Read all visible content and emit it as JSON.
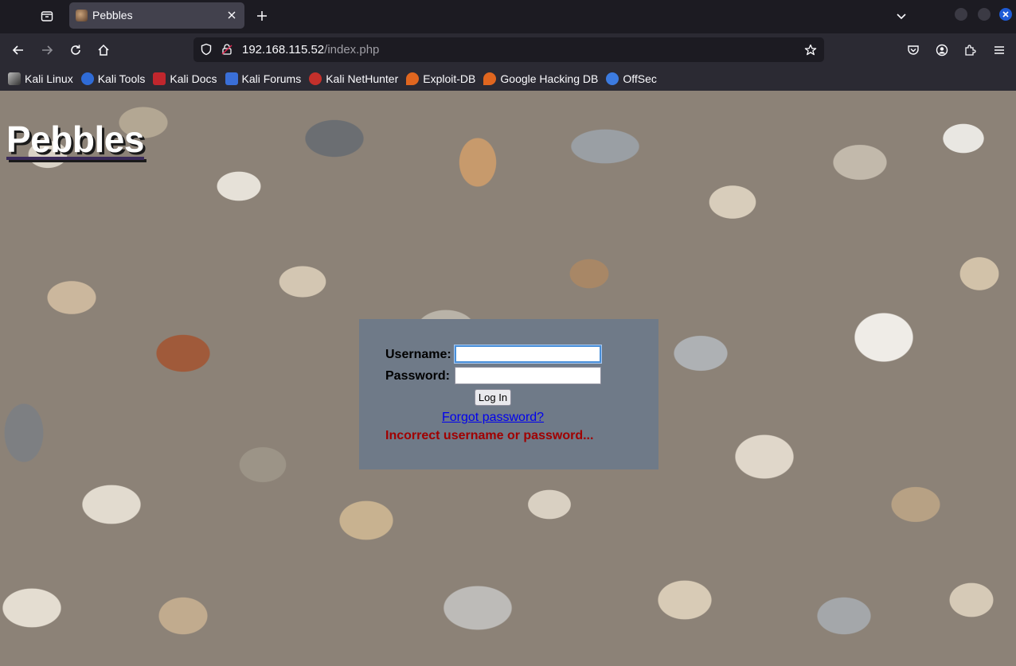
{
  "browser": {
    "tab": {
      "title": "Pebbles"
    },
    "url": {
      "host": "192.168.115.52",
      "path": "/index.php"
    },
    "bookmarks": [
      {
        "label": "Kali Linux",
        "icon": "kali-dragon-icon",
        "color": "#2b2a33"
      },
      {
        "label": "Kali Tools",
        "icon": "kali-tools-icon",
        "color": "#2f6bd6"
      },
      {
        "label": "Kali Docs",
        "icon": "kali-docs-icon",
        "color": "#c0262d"
      },
      {
        "label": "Kali Forums",
        "icon": "kali-forums-icon",
        "color": "#3a6fd8"
      },
      {
        "label": "Kali NetHunter",
        "icon": "kali-nethunter-icon",
        "color": "#c4302b"
      },
      {
        "label": "Exploit-DB",
        "icon": "exploit-db-icon",
        "color": "#e0661f"
      },
      {
        "label": "Google Hacking DB",
        "icon": "ghdb-icon",
        "color": "#e0661f"
      },
      {
        "label": "OffSec",
        "icon": "offsec-icon",
        "color": "#3c7be0"
      }
    ]
  },
  "page": {
    "title": "Pebbles",
    "login": {
      "username_label": "Username:",
      "password_label": "Password:",
      "username_value": "",
      "password_value": "",
      "submit_label": "Log In",
      "forgot_link": "Forgot password?",
      "error_message": "Incorrect username or password..."
    }
  }
}
